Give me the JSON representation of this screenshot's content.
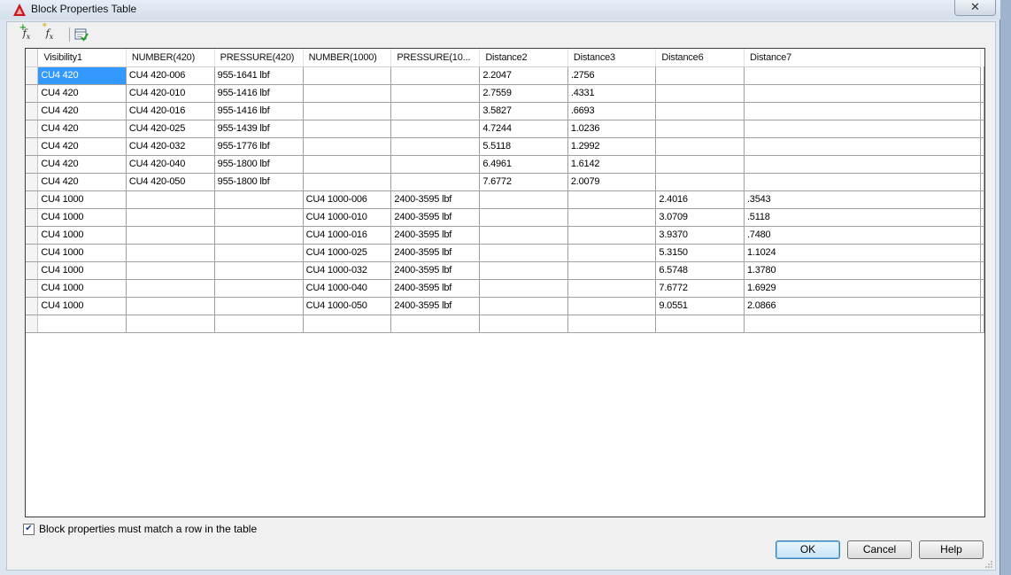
{
  "window": {
    "title": "Block Properties Table",
    "close_glyph": "✕",
    "accent": "#3399ff"
  },
  "toolbar": {
    "icons": [
      "add-fx-icon",
      "new-fx-icon",
      "audit-table-icon"
    ]
  },
  "table": {
    "columns": [
      "Visibility1",
      "NUMBER(420)",
      "PRESSURE(420)",
      "NUMBER(1000)",
      "PRESSURE(10...",
      "Distance2",
      "Distance3",
      "Distance6",
      "Distance7"
    ],
    "rows": [
      [
        "CU4 420",
        "CU4 420-006",
        "955-1641 lbf",
        "",
        "",
        "2.2047",
        ".2756",
        "",
        ""
      ],
      [
        "CU4 420",
        "CU4 420-010",
        "955-1416 lbf",
        "",
        "",
        "2.7559",
        ".4331",
        "",
        ""
      ],
      [
        "CU4 420",
        "CU4 420-016",
        "955-1416 lbf",
        "",
        "",
        "3.5827",
        ".6693",
        "",
        ""
      ],
      [
        "CU4 420",
        "CU4 420-025",
        "955-1439 lbf",
        "",
        "",
        "4.7244",
        "1.0236",
        "",
        ""
      ],
      [
        "CU4 420",
        "CU4 420-032",
        "955-1776 lbf",
        "",
        "",
        "5.5118",
        "1.2992",
        "",
        ""
      ],
      [
        "CU4 420",
        "CU4 420-040",
        "955-1800 lbf",
        "",
        "",
        "6.4961",
        "1.6142",
        "",
        ""
      ],
      [
        "CU4 420",
        "CU4 420-050",
        "955-1800 lbf",
        "",
        "",
        "7.6772",
        "2.0079",
        "",
        ""
      ],
      [
        "CU4 1000",
        "",
        "",
        "CU4 1000-006",
        "2400-3595 lbf",
        "",
        "",
        "2.4016",
        ".3543"
      ],
      [
        "CU4 1000",
        "",
        "",
        "CU4 1000-010",
        "2400-3595 lbf",
        "",
        "",
        "3.0709",
        ".5118"
      ],
      [
        "CU4 1000",
        "",
        "",
        "CU4 1000-016",
        "2400-3595 lbf",
        "",
        "",
        "3.9370",
        ".7480"
      ],
      [
        "CU4 1000",
        "",
        "",
        "CU4 1000-025",
        "2400-3595 lbf",
        "",
        "",
        "5.3150",
        "1.1024"
      ],
      [
        "CU4 1000",
        "",
        "",
        "CU4 1000-032",
        "2400-3595 lbf",
        "",
        "",
        "6.5748",
        "1.3780"
      ],
      [
        "CU4 1000",
        "",
        "",
        "CU4 1000-040",
        "2400-3595 lbf",
        "",
        "",
        "7.6772",
        "1.6929"
      ],
      [
        "CU4 1000",
        "",
        "",
        "CU4 1000-050",
        "2400-3595 lbf",
        "",
        "",
        "9.0551",
        "2.0866"
      ],
      [
        "",
        "",
        "",
        "",
        "",
        "",
        "",
        "",
        ""
      ]
    ]
  },
  "footer": {
    "match_checkbox_label": "Block properties must match a row in the table",
    "match_checked": true,
    "ok_label": "OK",
    "cancel_label": "Cancel",
    "help_label": "Help"
  }
}
